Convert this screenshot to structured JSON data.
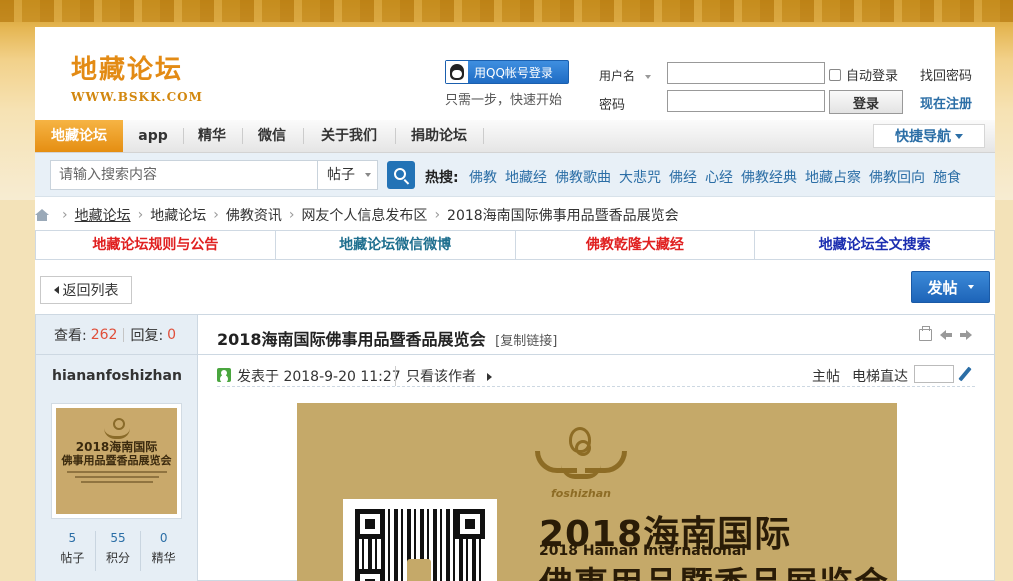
{
  "colors": {
    "accent_orange": "#e58e12",
    "link_blue": "#2b6ea6",
    "button_blue": "#2373b6",
    "red": "#e04e39"
  },
  "header": {
    "logo_title": "地藏论坛",
    "logo_url": "WWW.BSKK.COM",
    "qq_login": "用QQ帐号登录",
    "qq_hint": "只需一步，快速开始",
    "username_label": "用户名",
    "password_label": "密码",
    "auto_login": "自动登录",
    "find_password": "找回密码",
    "login_button": "登录",
    "register": "现在注册"
  },
  "nav": {
    "items": [
      "地藏论坛",
      "app",
      "精华",
      "微信",
      "关于我们",
      "捐助论坛"
    ],
    "active_index": 0,
    "quick_nav": "快捷导航"
  },
  "search": {
    "placeholder": "请输入搜索内容",
    "type": "帖子",
    "hot_label": "热搜:",
    "hot_words": [
      "佛教",
      "地藏经",
      "佛教歌曲",
      "大悲咒",
      "佛经",
      "心经",
      "佛教经典",
      "地藏占察",
      "佛教回向",
      "施食"
    ]
  },
  "breadcrumb": {
    "items": [
      "地藏论坛",
      "地藏论坛",
      "佛教资讯",
      "网友个人信息发布区",
      "2018海南国际佛事用品暨香品展览会"
    ]
  },
  "link_bar": [
    {
      "label": "地藏论坛规则与公告",
      "color": "#e02020"
    },
    {
      "label": "地藏论坛微信微博",
      "color": "#1f6f8f"
    },
    {
      "label": "佛教乾隆大藏经",
      "color": "#e02020"
    },
    {
      "label": "地藏论坛全文搜索",
      "color": "#1a2db0"
    }
  ],
  "actions": {
    "back": "返回列表",
    "post": "发帖"
  },
  "thread": {
    "views_label": "查看:",
    "views": "262",
    "replies_label": "回复:",
    "replies": "0",
    "author": "hiananfoshizhan",
    "title": "2018海南国际佛事用品暨香品展览会",
    "copy_link": "[复制链接]",
    "posted_label": "发表于",
    "posted_time": "2018-9-20 11:27",
    "only_author": "只看该作者",
    "floor": "主帖",
    "elevator": "电梯直达",
    "user_stats": [
      {
        "value": "5",
        "label": "帖子"
      },
      {
        "value": "55",
        "label": "积分"
      },
      {
        "value": "0",
        "label": "精华"
      }
    ],
    "avatar_text": {
      "line1": "2018海南国际",
      "line2": "佛事用品暨香品展览会"
    },
    "image": {
      "brand": "foshizhan",
      "title_cn": "2018海南国际",
      "title_en": "2018 Hainan International",
      "subtitle_cn": "佛事用品暨香品展览会"
    }
  }
}
